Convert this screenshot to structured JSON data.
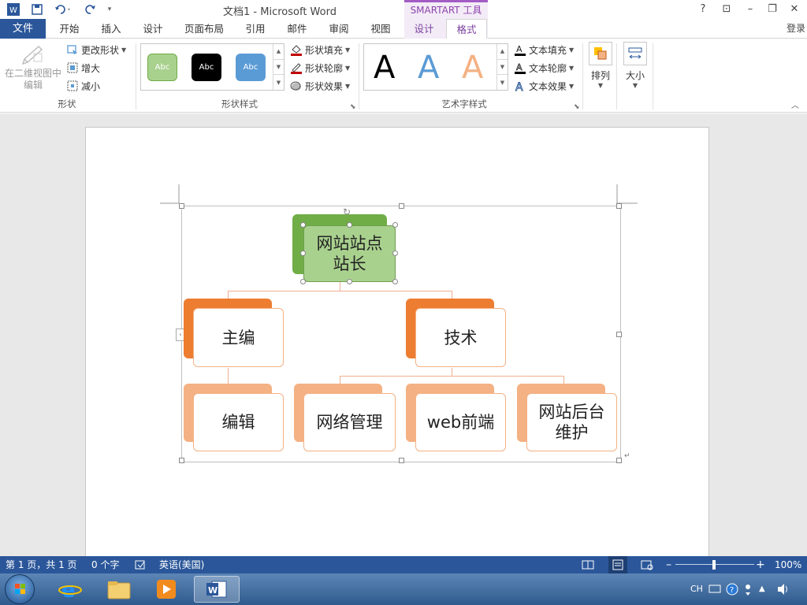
{
  "window": {
    "title": "文档1 - Microsoft Word",
    "context_group": "SMARTART 工具",
    "controls": [
      "?",
      "⊡",
      "–",
      "❐",
      "✕"
    ]
  },
  "tabs": {
    "file": "文件",
    "items": [
      "开始",
      "插入",
      "设计",
      "页面布局",
      "引用",
      "邮件",
      "审阅",
      "视图"
    ],
    "context_items": [
      "设计",
      "格式"
    ],
    "active": "格式",
    "signin": "登录"
  },
  "ribbon": {
    "shape_group": {
      "label": "形状",
      "edit_in_2d": "在二维视图中编辑",
      "change_shape": "更改形状",
      "larger": "增大",
      "smaller": "减小"
    },
    "shape_styles": {
      "label": "形状样式",
      "swatches": [
        {
          "text": "Abc",
          "color": "#a9d18e"
        },
        {
          "text": "Abc",
          "color": "#000000"
        },
        {
          "text": "Abc",
          "color": "#5b9bd5"
        }
      ],
      "fill": "形状填充",
      "outline": "形状轮廓",
      "effects": "形状效果"
    },
    "wordart_styles": {
      "label": "艺术字样式",
      "samples": [
        {
          "text": "A",
          "color": "#000000"
        },
        {
          "text": "A",
          "color": "#5b9bd5"
        },
        {
          "text": "A",
          "color": "#f4b183"
        }
      ],
      "text_fill": "文本填充",
      "text_outline": "文本轮廓",
      "text_effects": "文本效果"
    },
    "arrange": "排列",
    "size": "大小"
  },
  "smartart": {
    "root": "网站站点\n站长",
    "level2": [
      "主编",
      "技术"
    ],
    "level3": [
      "编辑",
      "网络管理",
      "web前端",
      "网站后台\n维护"
    ],
    "colors": {
      "root_back": "#70ad47",
      "root_front": "#a9d18e",
      "l2_back": "#ed7d31",
      "l3_back": "#f4b183",
      "connector": "#f0b08f"
    }
  },
  "statusbar": {
    "page": "第 1 页，共 1 页",
    "words": "0 个字",
    "language": "英语(美国)",
    "zoom": "100%"
  },
  "taskbar": {
    "tray_lang": "CH"
  }
}
